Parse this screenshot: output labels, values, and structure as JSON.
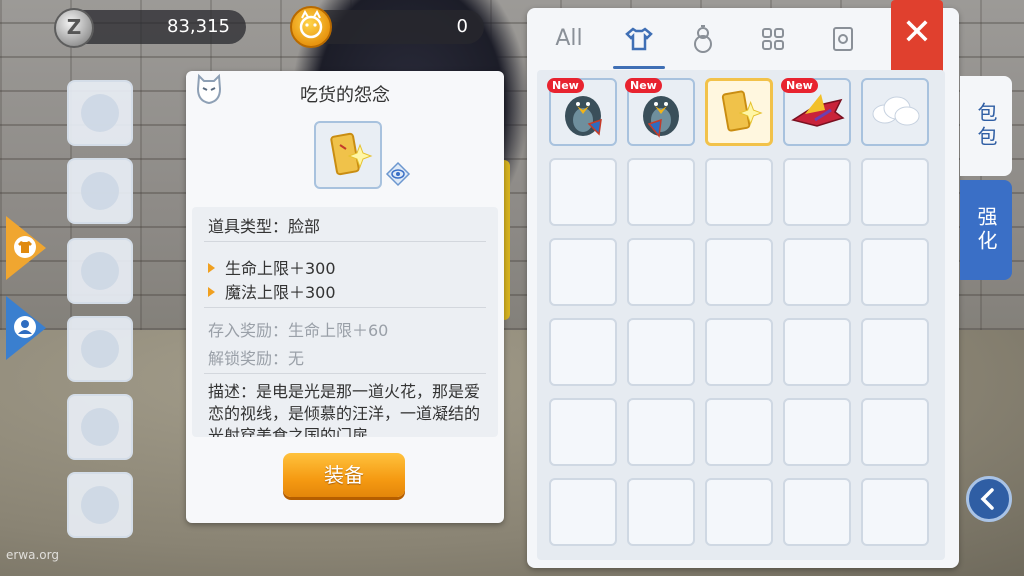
{
  "hud": {
    "zeny": "83,315",
    "zeny_coin_glyph": "Z",
    "cat_coin": "0"
  },
  "tooltip": {
    "title": "吃货的怨念",
    "type_line": "道具类型：脸部",
    "stats": [
      "生命上限＋300",
      "魔法上限＋300"
    ],
    "deposit_reward": "存入奖励：生命上限＋60",
    "unlock_reward": "解锁奖励：无",
    "description": "描述：是电是光是那一道火花，那是爱恋的视线，是倾慕的汪洋，一道凝结的光射穿美食之国的门扉",
    "equip_button": "装备"
  },
  "inventory": {
    "tab_all": "All",
    "tab_icons": [
      "shirt-icon",
      "gourd-icon",
      "grid-icon",
      "card-icon"
    ],
    "new_badge": "New",
    "side_tabs": [
      "包包",
      "强化"
    ]
  },
  "watermark": "erwa.org",
  "colors": {
    "accent_blue": "#3a6fc6",
    "close_red": "#e0402e",
    "button_orange": "#f59a12",
    "new_red": "#e8232f"
  }
}
